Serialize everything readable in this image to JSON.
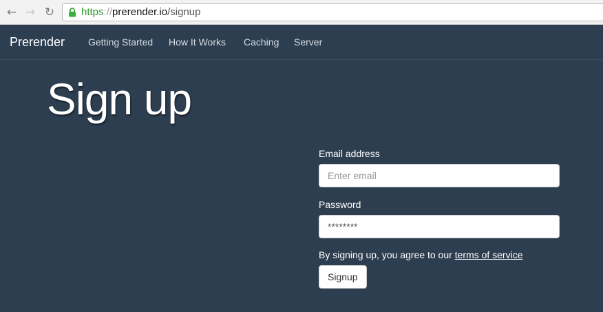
{
  "browser": {
    "url_scheme": "https",
    "url_separator": "://",
    "url_host": "prerender.io",
    "url_path": "/signup",
    "back_icon": "arrow-left",
    "forward_icon": "arrow-right",
    "reload_icon": "reload",
    "secure_icon": "lock"
  },
  "nav": {
    "brand": "Prerender",
    "links": [
      "Getting Started",
      "How It Works",
      "Caching",
      "Server"
    ]
  },
  "page": {
    "title": "Sign up"
  },
  "form": {
    "email_label": "Email address",
    "email_placeholder": "Enter email",
    "password_label": "Password",
    "password_value": "********",
    "terms_prefix": "By signing up, you agree to our ",
    "terms_link": "terms of service",
    "submit_label": "Signup"
  },
  "colors": {
    "page_background": "#2d3e50",
    "secure_green": "#2a9a2a"
  }
}
